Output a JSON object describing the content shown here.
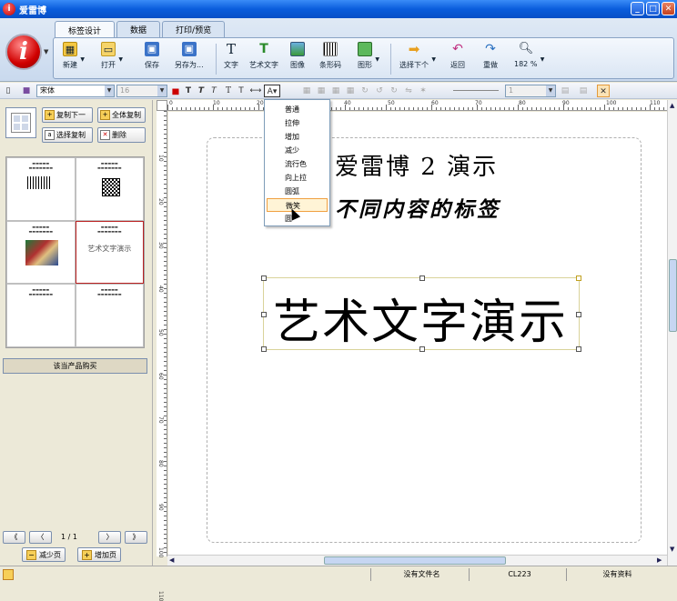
{
  "window": {
    "title": "爱雷博"
  },
  "ribbon": {
    "tabs": [
      "标签设计",
      "数据",
      "打印/预览"
    ],
    "buttons": {
      "new": "新建",
      "open": "打开",
      "save": "保存",
      "save_as": "另存为...",
      "text": "文字",
      "art_text": "艺术文字",
      "image": "图像",
      "barcode": "条形码",
      "shape": "图形",
      "select_next": "选择下个",
      "undo": "返回",
      "redo": "重做",
      "zoom": "182 %"
    }
  },
  "format_bar": {
    "font_name": "宋体",
    "font_size": "16",
    "line_width": "1"
  },
  "art_menu": {
    "items": [
      "普通",
      "拉伸",
      "增加",
      "减少",
      "流行色",
      "向上拉",
      "圆弧",
      "微笑",
      "圆"
    ],
    "highlighted_index": 7
  },
  "left_panel": {
    "copy_next": "复制下一",
    "copy_all": "全体复制",
    "select_copy": "选择复制",
    "delete": "删除",
    "thumb_art_text": "艺术文字演示",
    "buy": "该当产品购买",
    "pager": {
      "first": "《",
      "prev": "〈",
      "page": "1 / 1",
      "next": "〉",
      "last": "》"
    },
    "reduce_page": "减少页",
    "add_page": "增加页"
  },
  "ruler": {
    "h_ticks": [
      "0",
      "10",
      "20",
      "30",
      "40",
      "50",
      "60",
      "70",
      "80",
      "90",
      "100",
      "110"
    ],
    "v_ticks": [
      "10",
      "20",
      "30",
      "40",
      "50",
      "60",
      "70",
      "80",
      "90",
      "100",
      "110"
    ]
  },
  "canvas": {
    "line1": "爱雷博 2 演示",
    "line2": "不同内容的标签",
    "art_text": "艺术文字演示"
  },
  "status": {
    "file": "没有文件名",
    "code": "CL223",
    "data": "没有资料"
  }
}
